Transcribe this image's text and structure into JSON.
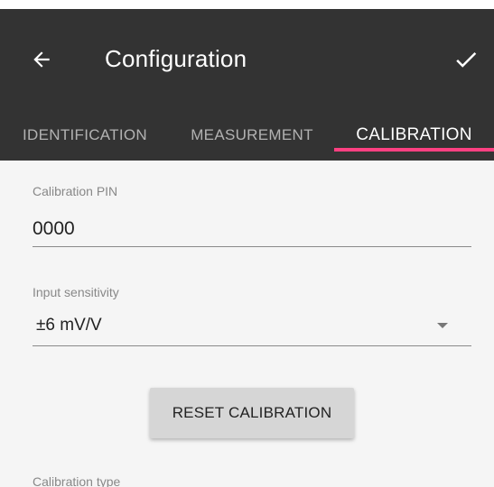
{
  "appbar": {
    "title": "Configuration",
    "back_icon": "arrow-left-icon",
    "confirm_icon": "check-icon",
    "background_color": "#333333"
  },
  "tabs": [
    {
      "label": "IDENTIFICATION",
      "active": false
    },
    {
      "label": "MEASUREMENT",
      "active": false
    },
    {
      "label": "CALIBRATION",
      "active": true
    }
  ],
  "accent_color": "#ff4081",
  "form": {
    "calibration_pin": {
      "label": "Calibration PIN",
      "value": "0000"
    },
    "input_sensitivity": {
      "label": "Input sensitivity",
      "value": "±6 mV/V",
      "icon": "dropdown-arrow-icon"
    },
    "reset_button_label": "RESET CALIBRATION",
    "calibration_type": {
      "label": "Calibration type"
    }
  }
}
